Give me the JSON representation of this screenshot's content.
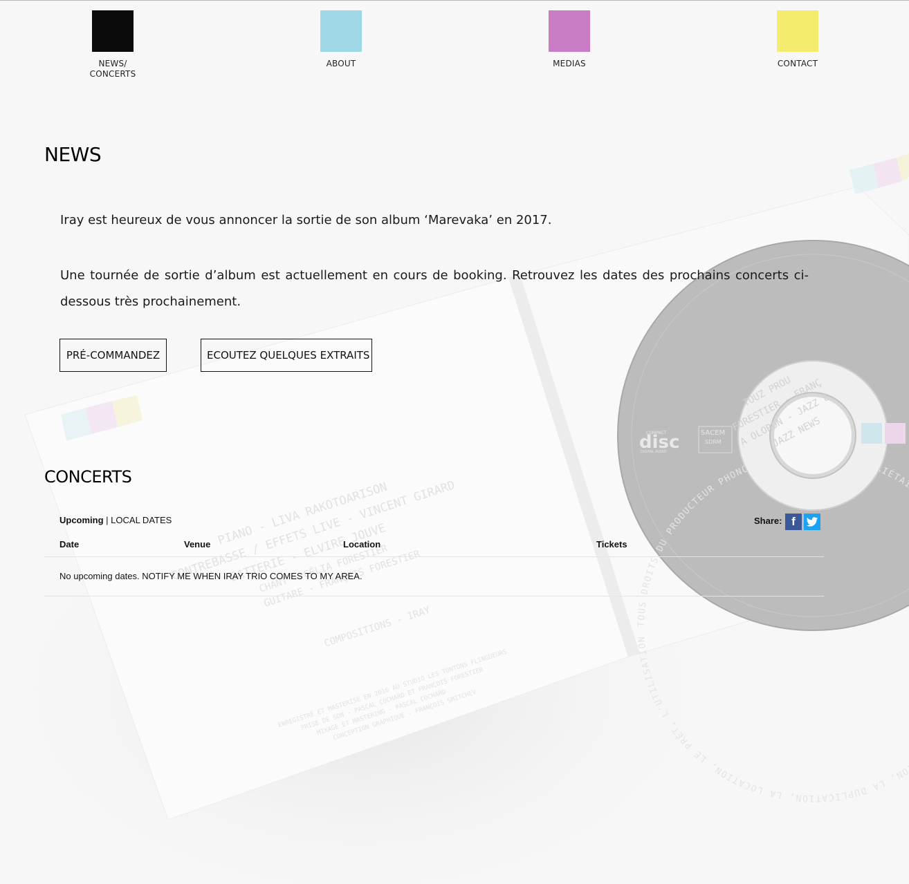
{
  "nav": {
    "items": [
      {
        "label": "NEWS/\nCONCERTS",
        "color": "#0b0b0b"
      },
      {
        "label": "ABOUT",
        "color": "#9fd8e4"
      },
      {
        "label": "MEDIAS",
        "color": "#c77cc4"
      },
      {
        "label": "CONTACT",
        "color": "#f3ec6e"
      }
    ]
  },
  "news": {
    "heading": "NEWS",
    "paragraph_1": "Iray est heureux de vous annoncer la sortie de son album ‘Marevaka’ en 2017.",
    "paragraph_2": "Une tournée de sortie d’album est actuellement en cours de booking. Retrouvez les dates des prochains concerts ci-dessous très prochainement.",
    "buttons": {
      "preorder": "PRÉ-COMMANDEZ",
      "listen": "ECOUTEZ QUELQUES EXTRAITS"
    }
  },
  "concerts": {
    "heading": "CONCERTS",
    "upcoming_label": "Upcoming",
    "separator": " | ",
    "local_dates": "LOCAL DATES",
    "share_label": "Share:",
    "share_facebook": "f",
    "columns": [
      "Date",
      "Venue",
      "Location",
      "Tickets"
    ],
    "no_dates_text": "No upcoming dates. ",
    "notify_link": "NOTIFY ME WHEN IRAY TRIO COMES TO MY AREA."
  },
  "background": {
    "liner_credits": [
      "PIANO - LIVA RAKOTOARISON",
      "CONTREBASSE / EFFETS LIVE - VINCENT GIRARD",
      "BATTERIE - ELVIRE JOUVE",
      "CHANT - CÉLIA FORESTIER",
      "GUITARE - FRANÇOIS FORESTIER",
      "COMPOSITIONS - IRAY",
      "ENREGISTRÉ ET MASTERISÉ EN 2016 AU STUDIO LES TONTONS FLINGUEURS",
      "PRISE DE SON - PASCAL COCHARD ET FRANÇOIS FORESTIER",
      "MIXAGE ET MASTERING - PASCAL COCHARD",
      "CONCEPTION GRAPHIQUE - FRANÇOIS SMITCHEV"
    ],
    "disc_rim": "TOUS DROITS DU PRODUCTEUR PHONOGRAPHIQUE ET DU PROPRIÉTAIRE DE L'ŒUVRE ENREGISTRÉE RÉSERVÉS. SAUF AUTORISATION, LA DUPLICATION, LA LOCATION, LE PRÊT, L'UTILISATION DE CE DISQUE POUR EXÉCUTION PUBLIQUE ET RADIODIFFUSION",
    "disc_center": [
      "TOUZ PROU",
      "FORESTIER - FRANÇ",
      "A OLORON - JAZZ E",
      "JAZZ NEWS"
    ],
    "disc_logo_top": "COMPACT",
    "disc_logo": "disc",
    "disc_logo_sub": "DIGITAL AUDIO",
    "sacem": "SACEM",
    "sdrm": "SDRM"
  }
}
